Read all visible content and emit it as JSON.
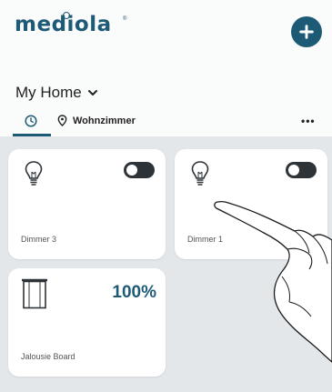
{
  "app": {
    "brand": "mediola",
    "registered_mark": "®"
  },
  "header": {
    "home_title": "My Home"
  },
  "tabs": {
    "room_label": "Wohnzimmer",
    "more": "•••"
  },
  "devices": [
    {
      "label": "Dimmer 3",
      "type": "dimmer",
      "state": "off"
    },
    {
      "label": "Dimmer 1",
      "type": "dimmer",
      "state": "off"
    },
    {
      "label": "Jalousie Board",
      "type": "blind",
      "value": "100%"
    }
  ],
  "icons": [
    "add-icon",
    "chevron-down-icon",
    "clock-icon",
    "location-pin-icon",
    "more-icon",
    "bulb-icon",
    "blind-icon",
    "hand-pointer"
  ],
  "colors": {
    "accent": "#1d5a76",
    "content_bg": "#e4e7ea",
    "toggle_off": "#2e3338"
  }
}
